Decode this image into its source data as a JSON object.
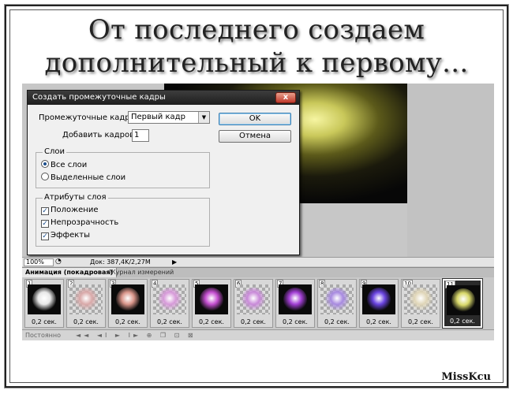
{
  "headline": {
    "line1": "От последнего создаем",
    "line2": "дополнительный к первому..."
  },
  "dialog": {
    "title": "Создать промежуточные кадры",
    "close_glyph": "x",
    "tween_label": "Промежуточные кадры:",
    "tween_value": "Первый кадр",
    "add_frames_label": "Добавить кадров:",
    "add_frames_value": "1",
    "ok_label": "OK",
    "cancel_label": "Отмена",
    "layers_group": {
      "legend": "Слои",
      "options": [
        {
          "label": "Все слои",
          "selected": true
        },
        {
          "label": "Выделенные слои",
          "selected": false
        }
      ]
    },
    "attrs_group": {
      "legend": "Атрибуты слоя",
      "options": [
        {
          "label": "Положение",
          "checked": true
        },
        {
          "label": "Непрозрачность",
          "checked": true
        },
        {
          "label": "Эффекты",
          "checked": true
        }
      ]
    }
  },
  "statusbar": {
    "zoom": "100%",
    "doc": "Док: 387,4K/2,27M"
  },
  "panel_tabs": {
    "animation": "Анимация (покадровая)",
    "measurements": "Журнал измерений"
  },
  "frames": [
    {
      "num": "1",
      "delay": "0,2 сек.",
      "color": "#e8e8e8",
      "dark_bg": true
    },
    {
      "num": "2",
      "delay": "0,2 сек.",
      "color": "#d9a9a9",
      "dark_bg": false
    },
    {
      "num": "3",
      "delay": "0,2 сек.",
      "color": "#d9958a",
      "dark_bg": true
    },
    {
      "num": "4",
      "delay": "0,2 сек.",
      "color": "#d79ad9",
      "dark_bg": false
    },
    {
      "num": "5",
      "delay": "0,2 сек.",
      "color": "#c44fd0",
      "dark_bg": true
    },
    {
      "num": "6",
      "delay": "0,2 сек.",
      "color": "#c98ad9",
      "dark_bg": false
    },
    {
      "num": "7",
      "delay": "0,2 сек.",
      "color": "#a23fd4",
      "dark_bg": true
    },
    {
      "num": "8",
      "delay": "0,2 сек.",
      "color": "#a88ae0",
      "dark_bg": false
    },
    {
      "num": "9",
      "delay": "0,2 сек.",
      "color": "#6a44e0",
      "dark_bg": true
    },
    {
      "num": "10",
      "delay": "0,2 сек.",
      "color": "#e0d6b8",
      "dark_bg": false
    },
    {
      "num": "11",
      "delay": "0,2 сек.",
      "color": "#d8d86a",
      "dark_bg": true,
      "selected": true
    }
  ],
  "anim_toolbar": {
    "loop": "Постоянно",
    "controls": "◄◄ ◄I ► I► ⊕ ❐ ⊡ ⊠"
  },
  "signature": "MissKcu"
}
